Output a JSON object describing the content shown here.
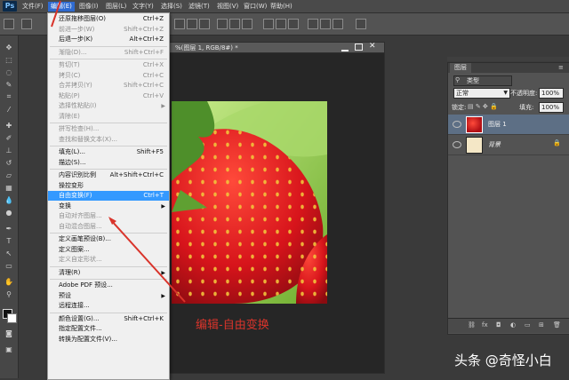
{
  "app": {
    "logo": "Ps"
  },
  "menubar": {
    "items": [
      "文件(F)",
      "编辑(E)",
      "图像(I)",
      "图层(L)",
      "文字(Y)",
      "选择(S)",
      "滤镜(T)",
      "视图(V)",
      "窗口(W)",
      "帮助(H)"
    ],
    "active": "编辑(E)"
  },
  "document": {
    "title": "%(图层 1, RGB/8#) *"
  },
  "layers_panel": {
    "tab": "图层",
    "filter": "类型",
    "blend_mode": "正常",
    "opacity_label": "不透明度:",
    "opacity_value": "100%",
    "lock_label": "锁定:",
    "fill_label": "填充:",
    "fill_value": "100%",
    "layers": [
      {
        "name": "图层 1",
        "selected": true
      },
      {
        "name": "背景",
        "selected": false
      }
    ]
  },
  "edit_menu": {
    "items": [
      {
        "label": "还原拖移图层(O)",
        "shortcut": "Ctrl+Z",
        "enabled": true
      },
      {
        "label": "前进一步(W)",
        "shortcut": "Shift+Ctrl+Z",
        "enabled": false
      },
      {
        "label": "后退一步(K)",
        "shortcut": "Alt+Ctrl+Z",
        "enabled": true
      },
      {
        "separator": true
      },
      {
        "label": "渐隐(D)...",
        "shortcut": "Shift+Ctrl+F",
        "enabled": false
      },
      {
        "separator": true
      },
      {
        "label": "剪切(T)",
        "shortcut": "Ctrl+X",
        "enabled": false
      },
      {
        "label": "拷贝(C)",
        "shortcut": "Ctrl+C",
        "enabled": false
      },
      {
        "label": "合并拷贝(Y)",
        "shortcut": "Shift+Ctrl+C",
        "enabled": false
      },
      {
        "label": "粘贴(P)",
        "shortcut": "Ctrl+V",
        "enabled": false
      },
      {
        "label": "选择性粘贴(I)",
        "shortcut": "",
        "enabled": false,
        "submenu": true
      },
      {
        "label": "清除(E)",
        "shortcut": "",
        "enabled": false
      },
      {
        "separator": true
      },
      {
        "label": "拼写检查(H)...",
        "shortcut": "",
        "enabled": false
      },
      {
        "label": "查找和替换文本(X)...",
        "shortcut": "",
        "enabled": false
      },
      {
        "separator": true
      },
      {
        "label": "填充(L)...",
        "shortcut": "Shift+F5",
        "enabled": true
      },
      {
        "label": "描边(S)...",
        "shortcut": "",
        "enabled": true
      },
      {
        "separator": true
      },
      {
        "label": "内容识别比例",
        "shortcut": "Alt+Shift+Ctrl+C",
        "enabled": true
      },
      {
        "label": "操控变形",
        "shortcut": "",
        "enabled": true
      },
      {
        "label": "自由变换(F)",
        "shortcut": "Ctrl+T",
        "enabled": true,
        "highlighted": true
      },
      {
        "label": "变换",
        "shortcut": "",
        "enabled": true,
        "submenu": true
      },
      {
        "label": "自动对齐图层...",
        "shortcut": "",
        "enabled": false
      },
      {
        "label": "自动混合图层...",
        "shortcut": "",
        "enabled": false
      },
      {
        "separator": true
      },
      {
        "label": "定义画笔预设(B)...",
        "shortcut": "",
        "enabled": true
      },
      {
        "label": "定义图案...",
        "shortcut": "",
        "enabled": true
      },
      {
        "label": "定义自定形状...",
        "shortcut": "",
        "enabled": false
      },
      {
        "separator": true
      },
      {
        "label": "清理(R)",
        "shortcut": "",
        "enabled": true,
        "submenu": true
      },
      {
        "separator": true
      },
      {
        "label": "Adobe PDF 预设...",
        "shortcut": "",
        "enabled": true
      },
      {
        "label": "预设",
        "shortcut": "",
        "enabled": true,
        "submenu": true
      },
      {
        "label": "远程连接...",
        "shortcut": "",
        "enabled": true
      },
      {
        "separator": true
      },
      {
        "label": "颜色设置(G)...",
        "shortcut": "Shift+Ctrl+K",
        "enabled": true
      },
      {
        "label": "指定配置文件...",
        "shortcut": "",
        "enabled": true
      },
      {
        "label": "转换为配置文件(V)...",
        "shortcut": "",
        "enabled": true
      }
    ]
  },
  "annotation": "编辑-自由变换",
  "watermark": "头条 @奇怪小白",
  "colors": {
    "accent": "#3399ff",
    "annotation": "#d9342b"
  }
}
